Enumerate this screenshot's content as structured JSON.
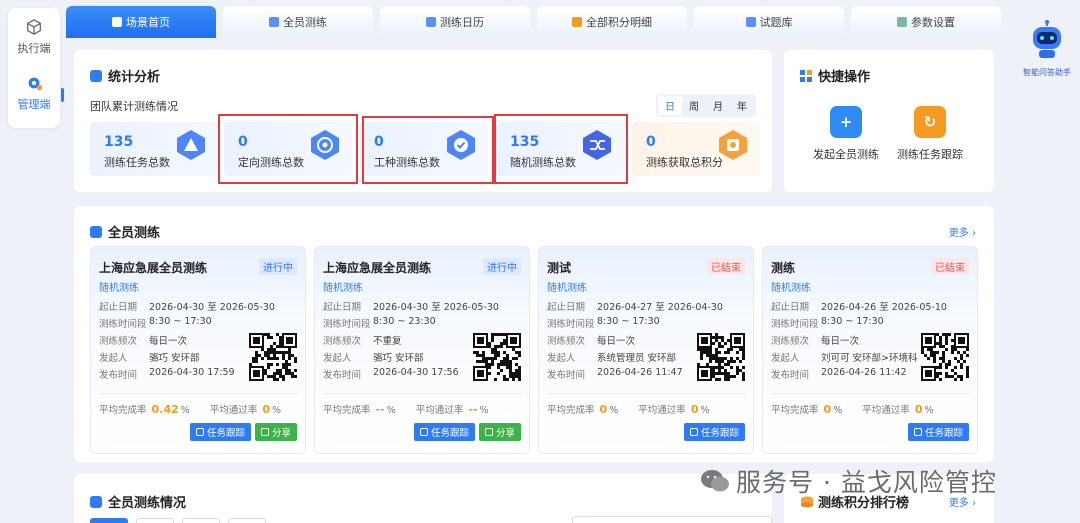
{
  "sidebar": {
    "exec_label": "执行端",
    "manage_label": "管理端"
  },
  "tabs": [
    {
      "label": "场景首页",
      "active": true,
      "icon": "home-icon"
    },
    {
      "label": "全员测练",
      "active": false,
      "icon": "document-icon"
    },
    {
      "label": "测练日历",
      "active": false,
      "icon": "calendar-icon"
    },
    {
      "label": "全部积分明细",
      "active": false,
      "icon": "coins-icon"
    },
    {
      "label": "试题库",
      "active": false,
      "icon": "list-icon"
    },
    {
      "label": "参数设置",
      "active": false,
      "icon": "sliders-icon"
    }
  ],
  "assistant": {
    "label": "智能问答助手",
    "icon": "robot-icon"
  },
  "stats": {
    "title": "统计分析",
    "subtitle": "团队累计测练情况",
    "periods": [
      "日",
      "周",
      "月",
      "年"
    ],
    "active_period": "日",
    "items": [
      {
        "value": "135",
        "label": "测练任务总数",
        "icon": "triangle-cube-icon"
      },
      {
        "value": "0",
        "label": "定向测练总数",
        "icon": "target-cube-icon"
      },
      {
        "value": "0",
        "label": "工种测练总数",
        "icon": "check-cube-icon"
      },
      {
        "value": "135",
        "label": "随机测练总数",
        "icon": "shuffle-cube-icon"
      },
      {
        "value": "0",
        "label": "测练获取总积分",
        "icon": "coin-cube-icon"
      }
    ]
  },
  "quick": {
    "title": "快捷操作",
    "buttons": [
      {
        "label": "发起全员测练",
        "icon": "plus-doc-icon",
        "color": "#2f8cf6"
      },
      {
        "label": "测练任务跟踪",
        "icon": "refresh-icon",
        "color": "#f59a23"
      }
    ]
  },
  "training": {
    "title": "全员测练",
    "more": "更多",
    "cards": [
      {
        "title": "上海应急展全员测练",
        "status": "进行中",
        "status_type": "running",
        "type": "随机测练",
        "rows": [
          {
            "k": "起止日期",
            "v": "2026-04-30 至 2026-05-30"
          },
          {
            "k": "测练时间段",
            "v": "8:30 ~ 17:30"
          },
          {
            "k": "测练频次",
            "v": "每日一次"
          },
          {
            "k": "发起人",
            "v": "骆巧  安环部"
          },
          {
            "k": "发布时间",
            "v": "2026-04-30 17:59"
          }
        ],
        "completion_label": "平均完成率",
        "completion": "0.42",
        "pass_label": "平均通过率",
        "pass": "0",
        "unit": "%",
        "track_label": "任务跟踪",
        "share_label": "分享",
        "has_share": true
      },
      {
        "title": "上海应急展全员测练",
        "status": "进行中",
        "status_type": "running",
        "type": "随机测练",
        "rows": [
          {
            "k": "起止日期",
            "v": "2026-04-30 至 2026-05-30"
          },
          {
            "k": "测练时间段",
            "v": "8:30 ~ 23:30"
          },
          {
            "k": "测练频次",
            "v": "不重复"
          },
          {
            "k": "发起人",
            "v": "骆巧  安环部"
          },
          {
            "k": "发布时间",
            "v": "2026-04-30 17:56"
          }
        ],
        "completion_label": "平均完成率",
        "completion": "--",
        "pass_label": "平均通过率",
        "pass": "--",
        "unit": "%",
        "track_label": "任务跟踪",
        "share_label": "分享",
        "has_share": true
      },
      {
        "title": "测试",
        "status": "已结束",
        "status_type": "ended",
        "type": "随机测练",
        "rows": [
          {
            "k": "起止日期",
            "v": "2026-04-27 至 2026-04-30"
          },
          {
            "k": "测练时间段",
            "v": "8:30 ~ 17:30"
          },
          {
            "k": "测练频次",
            "v": "每日一次"
          },
          {
            "k": "发起人",
            "v": "系统管理员  安环部"
          },
          {
            "k": "发布时间",
            "v": "2026-04-26 11:47"
          }
        ],
        "completion_label": "平均完成率",
        "completion": "0",
        "pass_label": "平均通过率",
        "pass": "0",
        "unit": "%",
        "track_label": "任务跟踪",
        "share_label": "",
        "has_share": false
      },
      {
        "title": "测练",
        "status": "已结束",
        "status_type": "ended",
        "type": "随机测练",
        "rows": [
          {
            "k": "起止日期",
            "v": "2026-04-26 至 2026-05-10"
          },
          {
            "k": "测练时间段",
            "v": "8:30 ~ 17:30"
          },
          {
            "k": "测练频次",
            "v": "每日一次"
          },
          {
            "k": "发起人",
            "v": "刘可可  安环部>环境科"
          },
          {
            "k": "发布时间",
            "v": "2026-04-26 11:42"
          }
        ],
        "completion_label": "平均完成率",
        "completion": "0",
        "pass_label": "平均通过率",
        "pass": "0",
        "unit": "%",
        "track_label": "任务跟踪",
        "share_label": "",
        "has_share": false
      }
    ]
  },
  "situation": {
    "title": "全员测练情况"
  },
  "ranking": {
    "title": "测练积分排行榜",
    "more": "更多"
  },
  "watermark": {
    "text": "服务号 · 益戈风险管控",
    "icon": "wechat-icon"
  }
}
